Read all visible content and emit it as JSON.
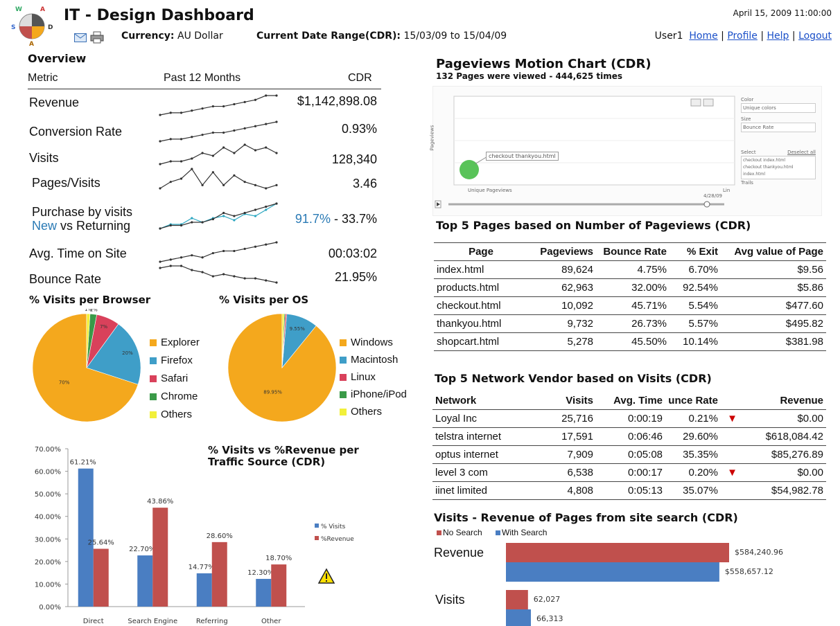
{
  "header": {
    "title": "IT - Design Dashboard",
    "datetime": "April 15, 2009 11:00:00",
    "currency_label": "Currency:",
    "currency_value": "AU Dollar",
    "daterange_label": "Current Date Range(CDR):",
    "daterange_value": "15/03/09 to 15/04/09",
    "user": "User1",
    "nav": [
      "Home",
      "Profile",
      "Help",
      "Logout"
    ],
    "logo_letters": [
      "W",
      "A",
      "S",
      "D",
      "A"
    ]
  },
  "overview": {
    "title": "Overview",
    "col_metric": "Metric",
    "col_past": "Past 12 Months",
    "col_cdr": "CDR",
    "rows": [
      {
        "label": "Revenue",
        "value": "$1,142,898.08",
        "spark": [
          2,
          3,
          3,
          4,
          5,
          6,
          6,
          7,
          8,
          9,
          11,
          11
        ]
      },
      {
        "label": "Conversion Rate",
        "value": "0.93%",
        "spark": [
          2,
          3,
          3,
          4,
          5,
          6,
          6,
          7,
          8,
          9,
          10,
          11
        ]
      },
      {
        "label": "Visits",
        "value": "128,340",
        "spark": [
          2,
          3,
          3,
          4,
          6,
          5,
          8,
          6,
          9,
          7,
          8,
          6
        ]
      },
      {
        "label": "Pages/Visits",
        "value": "3.46",
        "spark": [
          3,
          5,
          6,
          9,
          4,
          8,
          4,
          7,
          5,
          4,
          3,
          4
        ]
      },
      {
        "label_line1": "Purchase by visits",
        "label_new": "New",
        "label_rest": " vs Returning",
        "value_new": "91.7%",
        "value_rest": " - 33.7%",
        "spark": [
          2,
          4,
          4,
          7,
          5,
          7,
          8,
          6,
          9,
          8,
          11,
          14
        ],
        "spark2": [
          2,
          3,
          3,
          4,
          4,
          5,
          7,
          6,
          7,
          8,
          9,
          10
        ]
      },
      {
        "label": "Avg. Time on Site",
        "value": "00:03:02",
        "spark": [
          2,
          3,
          4,
          5,
          4,
          6,
          7,
          7,
          8,
          9,
          10,
          11
        ]
      },
      {
        "label": "Bounce Rate",
        "value": "21.95%",
        "spark": [
          9,
          10,
          10,
          8,
          7,
          5,
          6,
          5,
          4,
          4,
          3,
          2
        ]
      }
    ]
  },
  "browser_pie": {
    "title": "% Visits per Browser",
    "slices": [
      {
        "label": "Explorer",
        "value": 70,
        "text": "70%",
        "color": "#f4a81d"
      },
      {
        "label": "Firefox",
        "value": 20,
        "text": "20%",
        "color": "#3f9ec8"
      },
      {
        "label": "Safari",
        "value": 7,
        "text": "7%",
        "color": "#d9415b"
      },
      {
        "label": "Chrome",
        "value": 2,
        "text": "2%",
        "color": "#3a9a48"
      },
      {
        "label": "Others",
        "value": 1,
        "text": "1%",
        "color": "#f2f03a"
      }
    ]
  },
  "os_pie": {
    "title": "% Visits per OS",
    "slices": [
      {
        "label": "Windows",
        "value": 89.95,
        "text": "89.95%",
        "color": "#f4a81d"
      },
      {
        "label": "Macintosh",
        "value": 9.55,
        "text": "9.55%",
        "color": "#3f9ec8"
      },
      {
        "label": "Linux",
        "value": 0.45,
        "text": "0.45%",
        "color": "#d9415b"
      },
      {
        "label": "iPhone/iPod",
        "value": 0.34,
        "text": "0.34%",
        "color": "#3a9a48"
      },
      {
        "label": "Others",
        "value": 0.61,
        "text": "0.61%",
        "color": "#f2f03a"
      }
    ]
  },
  "chart_data": {
    "type": "bar",
    "title": "% Visits vs %Revenue per Traffic Source (CDR)",
    "categories": [
      "Direct",
      "Search Engine",
      "Referring",
      "Other"
    ],
    "series": [
      {
        "name": "% Visits",
        "values": [
          61.21,
          22.7,
          14.77,
          12.3
        ],
        "labels": [
          "61.21%",
          "22.70%",
          "14.77%",
          "12.30%"
        ],
        "color": "#4a7ec2"
      },
      {
        "name": "%Revenue",
        "values": [
          25.64,
          43.86,
          28.6,
          18.7
        ],
        "labels": [
          "25.64%",
          "43.86%",
          "28.60%",
          "18.70%"
        ],
        "color": "#c0504d"
      }
    ],
    "yticks": [
      "0.00%",
      "10.00%",
      "20.00%",
      "30.00%",
      "40.00%",
      "50.00%",
      "60.00%",
      "70.00%"
    ],
    "ylim": [
      0,
      70
    ],
    "legend": "right"
  },
  "motion_chart": {
    "title": "Pageviews Motion Chart (CDR)",
    "subtitle": "132 Pages were viewed - 444,625 times",
    "tooltip": "checkout thankyou.html",
    "x_label": "Unique Pageviews",
    "y_label": "Pageviews",
    "date": "4/28/09",
    "color_label": "Color",
    "color_value": "Unique colors",
    "size_label": "Size",
    "size_value": "Bounce Rate",
    "select_label": "Select",
    "deselect_label": "Deselect all",
    "items": [
      "checkout index.html",
      "checkout thankyou.html",
      "index.html"
    ],
    "trails_label": "Trails",
    "scale_label": "Lin"
  },
  "top_pages": {
    "title": "Top 5 Pages based on Number of Pageviews (CDR)",
    "headers": [
      "Page",
      "Pageviews",
      "Bounce Rate",
      "% Exit",
      "Avg value of Page"
    ],
    "rows": [
      [
        "index.html",
        "89,624",
        "4.75%",
        "6.70%",
        "$9.56"
      ],
      [
        "products.html",
        "62,963",
        "32.00%",
        "92.54%",
        "$5.86"
      ],
      [
        "checkout.html",
        "10,092",
        "45.71%",
        "5.54%",
        "$477.60"
      ],
      [
        "thankyou.html",
        "9,732",
        "26.73%",
        "5.57%",
        "$495.82"
      ],
      [
        "shopcart.html",
        "5,278",
        "45.50%",
        "10.14%",
        "$381.98"
      ]
    ]
  },
  "vendors": {
    "title": "Top 5 Network Vendor based on Visits (CDR)",
    "headers": [
      "Network",
      "Visits",
      "Avg. Time",
      "unce Rate",
      "Revenue"
    ],
    "rows": [
      [
        "Loyal Inc",
        "25,716",
        "0:00:19",
        "0.21%",
        "$0.00",
        true
      ],
      [
        "telstra internet",
        "17,591",
        "0:06:46",
        "29.60%",
        "$618,084.42",
        false
      ],
      [
        "optus internet",
        "7,909",
        "0:05:08",
        "35.35%",
        "$85,276.89",
        false
      ],
      [
        "level 3 com",
        "6,538",
        "0:00:17",
        "0.20%",
        "$0.00",
        true
      ],
      [
        "iinet limited",
        "4,808",
        "0:05:13",
        "35.07%",
        "$54,982.78",
        false
      ]
    ]
  },
  "search": {
    "title": "Visits - Revenue of Pages from site search (CDR)",
    "legend_no": "No Search",
    "legend_with": "With Search",
    "cat_revenue": "Revenue",
    "cat_visits": "Visits",
    "revenue_no": 584240.96,
    "revenue_no_label": "$584,240.96",
    "revenue_with": 558657.12,
    "revenue_with_label": "$558,657.12",
    "visits_no": 62027,
    "visits_no_label": "62,027",
    "visits_with": 66313,
    "visits_with_label": "66,313",
    "color_no": "#c0504d",
    "color_with": "#4a7ec2"
  }
}
